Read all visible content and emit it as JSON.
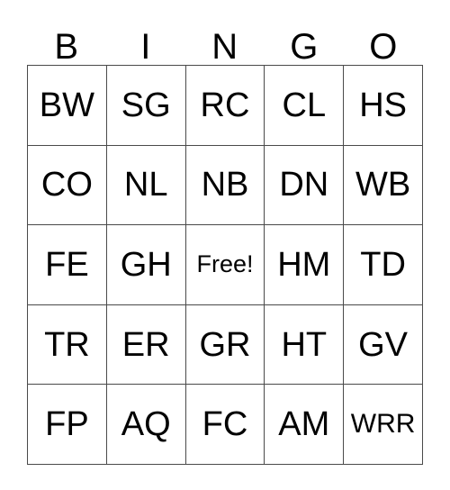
{
  "card": {
    "title": "BINGO",
    "header_letters": [
      "B",
      "I",
      "N",
      "G",
      "O"
    ],
    "free_space_label": "Free!",
    "grid_line_color": "#4a4a4a",
    "text_color": "#000000",
    "background_color": "#ffffff",
    "rows": 5,
    "columns": 5,
    "cells": [
      [
        "BW",
        "SG",
        "RC",
        "CL",
        "HS"
      ],
      [
        "CO",
        "NL",
        "NB",
        "DN",
        "WB"
      ],
      [
        "FE",
        "GH",
        "Free!",
        "HM",
        "TD"
      ],
      [
        "TR",
        "ER",
        "GR",
        "HT",
        "GV"
      ],
      [
        "FP",
        "AQ",
        "FC",
        "AM",
        "WRR"
      ]
    ]
  }
}
